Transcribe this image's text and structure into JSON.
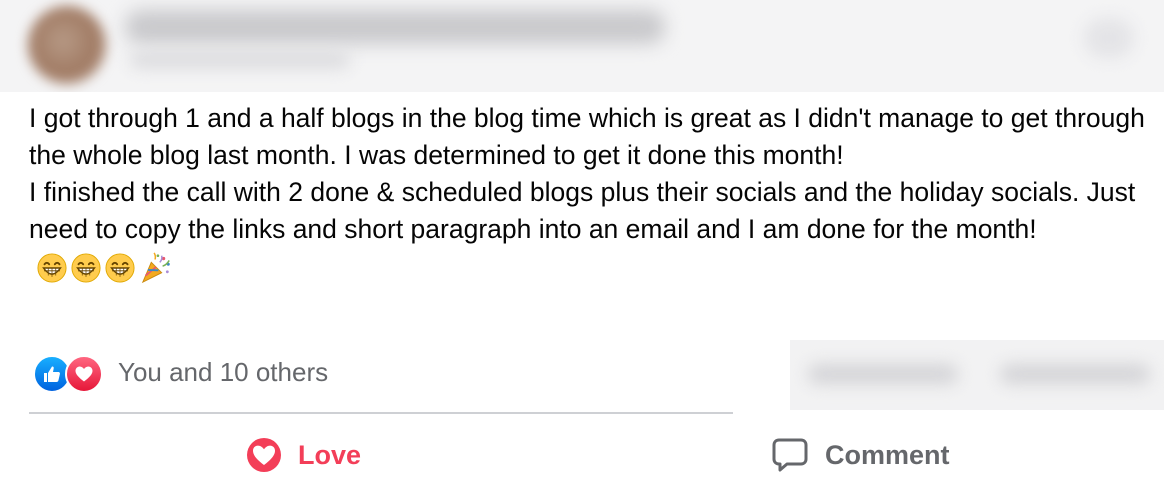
{
  "post": {
    "paragraphs": [
      "I got through 1 and a half blogs in the blog time which is great as I didn't manage to get through the whole blog last month. I was determined to get it done this month!",
      "I finished the call with 2 done & scheduled blogs plus their socials and the holiday socials. Just need to copy the links and short paragraph into an email and I am done for the month!"
    ],
    "emojis": [
      "grinning-face-with-smiling-eyes",
      "grinning-face-with-smiling-eyes",
      "grinning-face-with-smiling-eyes",
      "party-popper"
    ]
  },
  "reactions": {
    "icons": [
      "like-reaction-icon",
      "love-reaction-icon"
    ],
    "summary": "You and 10 others"
  },
  "actions": {
    "love_label": "Love",
    "comment_label": "Comment"
  },
  "colors": {
    "love_red": "#f33e58",
    "like_blue": "#0062df",
    "secondary_text": "#65676b",
    "divider": "#ced0d4"
  }
}
